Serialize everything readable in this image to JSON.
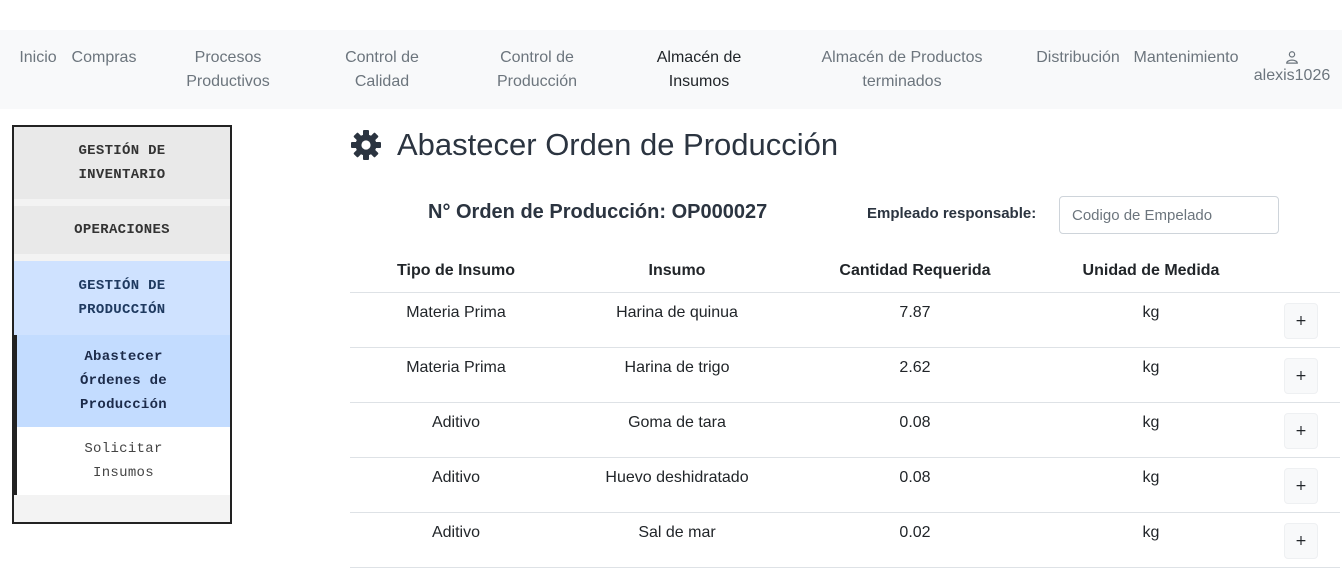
{
  "navbar": {
    "items": [
      {
        "label_1": "Inicio",
        "label_2": ""
      },
      {
        "label_1": "Compras",
        "label_2": ""
      },
      {
        "label_1": "Procesos",
        "label_2": "Productivos"
      },
      {
        "label_1": "Control de",
        "label_2": "Calidad"
      },
      {
        "label_1": "Control de",
        "label_2": "Producción"
      },
      {
        "label_1": "Almacén de",
        "label_2": "Insumos"
      },
      {
        "label_1": "Almacén de Productos",
        "label_2": "terminados"
      },
      {
        "label_1": "Distribución",
        "label_2": ""
      },
      {
        "label_1": "Mantenimiento",
        "label_2": ""
      }
    ],
    "user": {
      "icon": "user-icon",
      "name": "alexis1026"
    }
  },
  "sidemenu": {
    "items": [
      {
        "line_1": "GESTIÓN DE",
        "line_2": "INVENTARIO"
      },
      {
        "line_1": "OPERACIONES"
      },
      {
        "line_1": "GESTIÓN DE",
        "line_2": "PRODUCCIÓN"
      },
      {
        "line_1": "Abastecer",
        "line_2": "Órdenes de",
        "line_3": "Producción"
      },
      {
        "line_1": "Solicitar",
        "line_2": "Insumos"
      }
    ]
  },
  "main": {
    "title_icon": "gear-icon",
    "title": "Abastecer Orden de Producción",
    "order_number": "N° Orden de Producción: OP000027",
    "employee_label": "Empleado responsable:",
    "employee_placeholder": "Codigo de Empelado",
    "employee_value": ""
  },
  "table": {
    "headers": [
      "Tipo de Insumo",
      "Insumo",
      "Cantidad Requerida",
      "Unidad de Medida"
    ],
    "rows": [
      {
        "tipo": "Materia Prima",
        "insumo": "Harina de quinua",
        "cantidad": "7.87",
        "unidad": "kg",
        "action": "+"
      },
      {
        "tipo": "Materia Prima",
        "insumo": "Harina de trigo",
        "cantidad": "2.62",
        "unidad": "kg",
        "action": "+"
      },
      {
        "tipo": "Aditivo",
        "insumo": "Goma de tara",
        "cantidad": "0.08",
        "unidad": "kg",
        "action": "+"
      },
      {
        "tipo": "Aditivo",
        "insumo": "Huevo deshidratado",
        "cantidad": "0.08",
        "unidad": "kg",
        "action": "+"
      },
      {
        "tipo": "Aditivo",
        "insumo": "Sal de mar",
        "cantidad": "0.02",
        "unidad": "kg",
        "action": "+"
      }
    ]
  }
}
